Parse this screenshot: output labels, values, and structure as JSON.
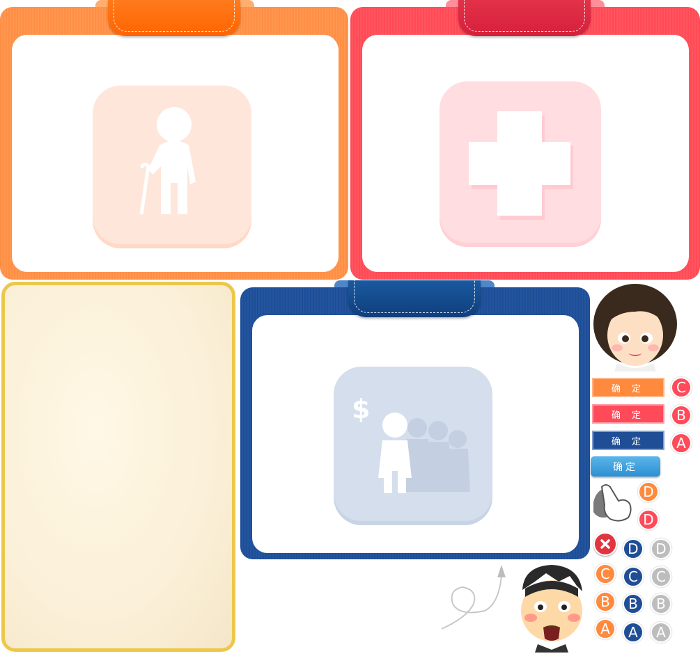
{
  "buttons": {
    "confirm_orange": "确 定",
    "confirm_red": "确 定",
    "confirm_blue": "确 定",
    "confirm_light": "确定"
  },
  "letters": {
    "red_c": "C",
    "red_b": "B",
    "red_a": "A",
    "orange_d": "D",
    "red_d": "D",
    "blue_d": "D",
    "gray_d": "D",
    "orange_c": "C",
    "blue_c": "C",
    "gray_c": "C",
    "orange_b": "B",
    "blue_b": "B",
    "gray_b": "B",
    "orange_a": "A",
    "blue_a": "A",
    "gray_a": "A"
  },
  "icons": {
    "orange_board": "elderly-person-icon",
    "red_board": "medical-cross-icon",
    "blue_board": "family-finance-icon"
  },
  "colors": {
    "orange": "#ff8e45",
    "red": "#ff4a55",
    "blue": "#1f4e96",
    "cream_border": "#ecc84a"
  }
}
